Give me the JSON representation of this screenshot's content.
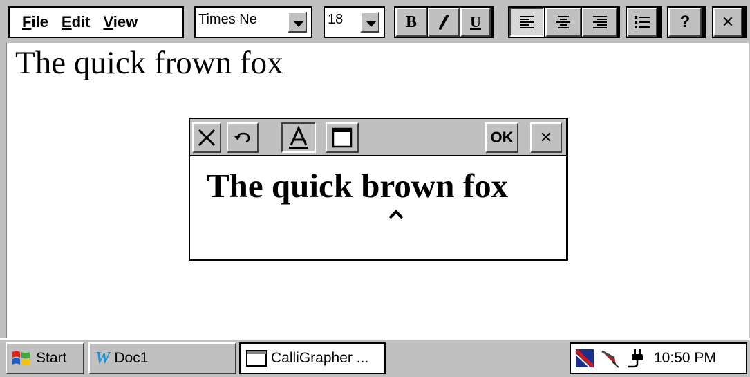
{
  "menu": {
    "file": "File",
    "file_u": "F",
    "file_rest": "ile",
    "edit": "Edit",
    "edit_u": "E",
    "edit_rest": "dit",
    "view": "View",
    "view_u": "V",
    "view_rest": "iew"
  },
  "toolbar": {
    "font_name": "Times Ne",
    "font_size": "18",
    "bold_label": "B",
    "italic_icon": "italic-icon",
    "underline_label": "U",
    "help_label": "?",
    "close_label": "✕"
  },
  "document": {
    "text": "The quick frown fox"
  },
  "calligrapher": {
    "recognized_text": "The quick brown fox",
    "ok_label": "OK",
    "close_label": "✕"
  },
  "taskbar": {
    "start_label": "Start",
    "doc_label": "Doc1",
    "doc_icon_letter": "W",
    "callig_label": "CalliGrapher ...",
    "clock": "10:50 PM"
  },
  "colors": {
    "face": "#c0c0c0",
    "window_bg": "#ffffff",
    "text": "#000000",
    "doc_icon": "#1f8fd6"
  }
}
